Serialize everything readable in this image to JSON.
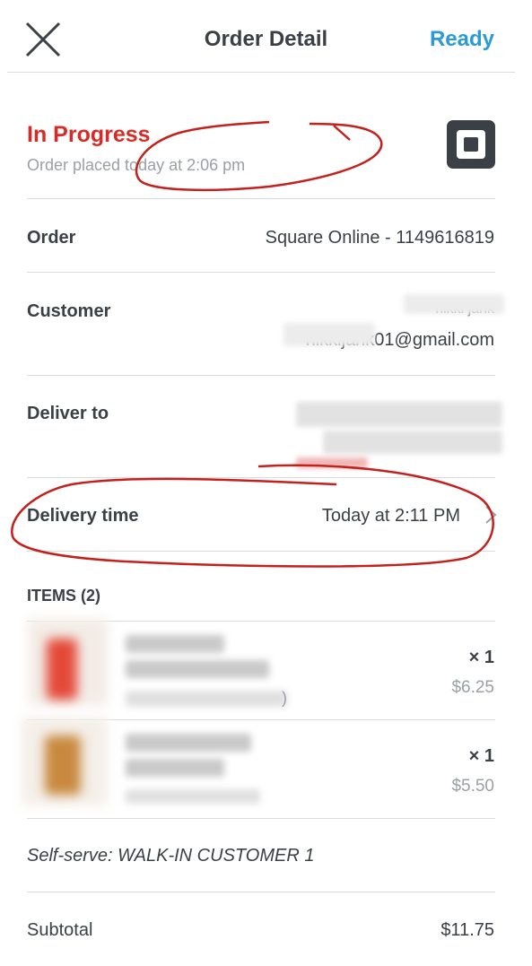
{
  "header": {
    "close_icon": "close-icon",
    "title": "Order Detail",
    "ready_label": "Ready"
  },
  "status": {
    "label": "In Progress",
    "placed": "Order placed today at 2:06 pm",
    "logo_icon": "square-logo-icon"
  },
  "rows": {
    "order_label": "Order",
    "order_value": "Square Online - 1149616819",
    "customer_label": "Customer",
    "customer_name_partial": "nikki jank",
    "customer_email_partial": "nikkijank01@gmail.com",
    "deliver_label": "Deliver to",
    "delivery_time_label": "Delivery time",
    "delivery_time_value": "Today at 2:11 PM"
  },
  "items": {
    "header": "ITEMS (2)",
    "list": [
      {
        "qty": "× 1",
        "price": "$6.25",
        "blurred_tail": ")"
      },
      {
        "qty": "× 1",
        "price": "$5.50"
      }
    ]
  },
  "note": "Self-serve: WALK-IN CUSTOMER 1",
  "totals": {
    "subtotal_label": "Subtotal",
    "subtotal_value": "$11.75"
  },
  "colors": {
    "accent_blue": "#2a9bd8",
    "status_red": "#d92b26",
    "annotation_red": "#c4201c"
  }
}
